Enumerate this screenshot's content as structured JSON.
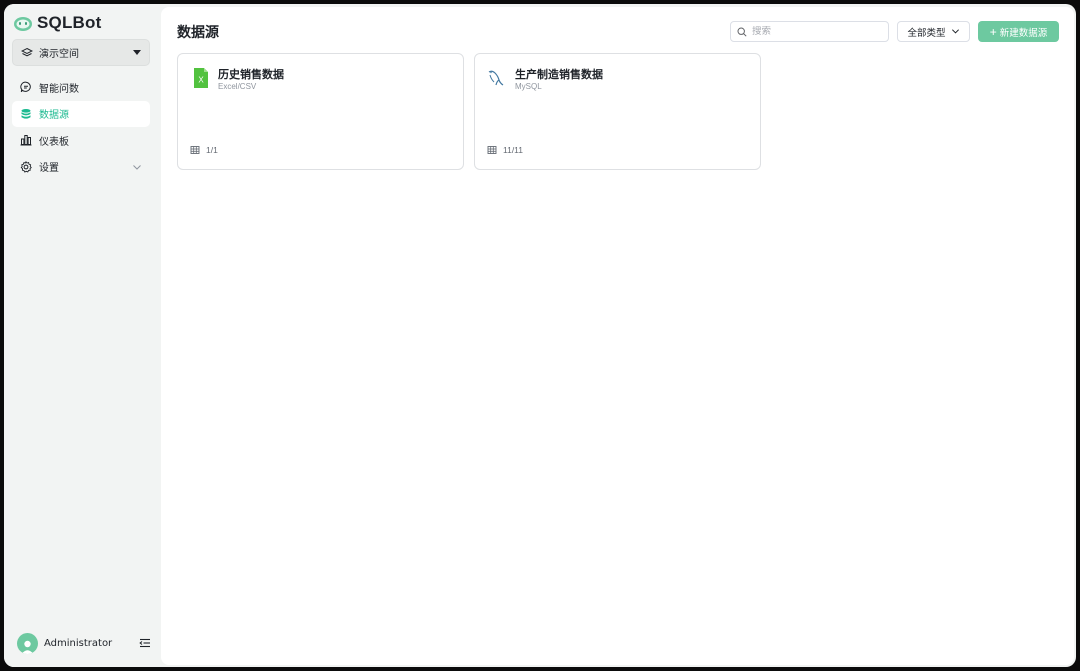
{
  "app": {
    "name": "SQLBot"
  },
  "sidebar": {
    "workspace": "演示空间",
    "items": [
      {
        "label": "智能问数",
        "icon": "chat-icon",
        "active": false
      },
      {
        "label": "数据源",
        "icon": "database-icon",
        "active": true
      },
      {
        "label": "仪表板",
        "icon": "dashboard-icon",
        "active": false
      },
      {
        "label": "设置",
        "icon": "gear-icon",
        "active": false
      }
    ],
    "user": {
      "name": "Administrator"
    }
  },
  "main": {
    "title": "数据源",
    "search": {
      "placeholder": "搜索",
      "value": ""
    },
    "type_filter": "全部类型",
    "new_button": "新建数据源",
    "cards": [
      {
        "name": "历史销售数据",
        "type": "Excel/CSV",
        "tables": "1/1",
        "icon": "excel-icon"
      },
      {
        "name": "生产制造销售数据",
        "type": "MySQL",
        "tables": "11/11",
        "icon": "mysql-icon"
      }
    ]
  },
  "colors": {
    "accent": "#1cba90",
    "button": "#6dc9a0",
    "sidebar_bg": "#f2f4f3"
  }
}
